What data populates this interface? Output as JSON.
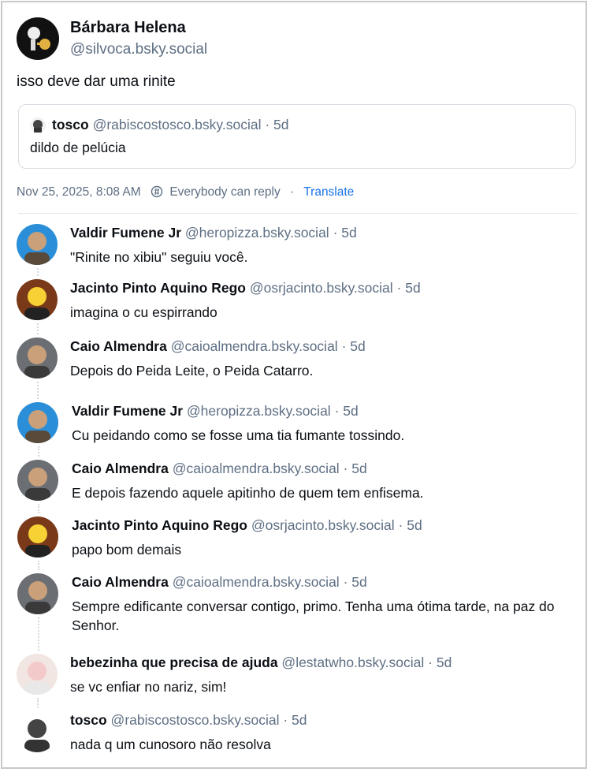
{
  "post": {
    "author_name": "Bárbara Helena",
    "author_handle": "@silvoca.bsky.social",
    "text": "isso deve dar uma rinite",
    "quote": {
      "author_name": "tosco",
      "author_handle": "@rabiscostosco.bsky.social",
      "separator": "·",
      "time": "5d",
      "text": "dildo de pelúcia"
    },
    "meta": {
      "timestamp": "Nov 25, 2025, 8:08 AM",
      "reply_setting": "Everybody can reply",
      "separator": "·",
      "translate_label": "Translate"
    }
  },
  "replies": [
    {
      "name": "Valdir Fumene Jr",
      "handle": "@heropizza.bsky.social",
      "time": "5d",
      "text": "\"Rinite no xibiu\" seguiu você."
    },
    {
      "name": "Jacinto Pinto Aquino Rego",
      "handle": "@osrjacinto.bsky.social",
      "time": "5d",
      "text": "imagina o cu espirrando"
    },
    {
      "name": "Caio Almendra",
      "handle": "@caioalmendra.bsky.social",
      "time": "5d",
      "text": "Depois do Peida Leite, o Peida Catarro."
    },
    {
      "name": "Valdir Fumene Jr",
      "handle": "@heropizza.bsky.social",
      "time": "5d",
      "text": "Cu peidando como se fosse uma tia fumante tossindo."
    },
    {
      "name": "Caio Almendra",
      "handle": "@caioalmendra.bsky.social",
      "time": "5d",
      "text": "E depois fazendo aquele apitinho de quem tem enfisema."
    },
    {
      "name": "Jacinto Pinto Aquino Rego",
      "handle": "@osrjacinto.bsky.social",
      "time": "5d",
      "text": "papo bom demais"
    },
    {
      "name": "Caio Almendra",
      "handle": "@caioalmendra.bsky.social",
      "time": "5d",
      "text": "Sempre edificante conversar contigo, primo. Tenha uma ótima tarde, na paz do Senhor."
    },
    {
      "name": "bebezinha que precisa de ajuda",
      "handle": "@lestatwho.bsky.social",
      "time": "5d",
      "text": "se vc enfiar no nariz, sim!"
    },
    {
      "name": "tosco",
      "handle": "@rabiscostosco.bsky.social",
      "time": "5d",
      "text": "nada q um cunosoro não resolva"
    }
  ],
  "separator": "·",
  "colors": {
    "accent": "#1a73e8",
    "muted": "#5e6f83",
    "text": "#0b0f14",
    "border": "#d9dde3"
  }
}
